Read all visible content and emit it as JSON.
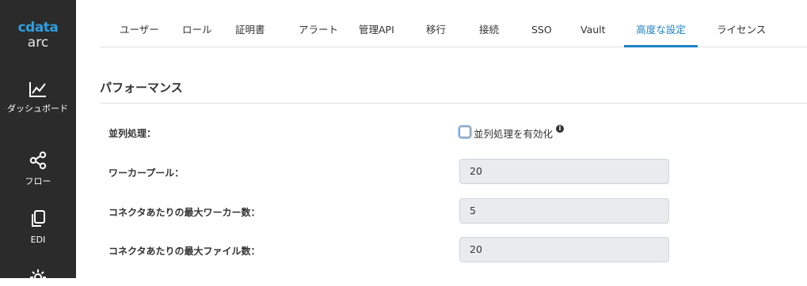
{
  "app": {
    "logo_text": "cdata",
    "logo_sub": "arc"
  },
  "sidebar": {
    "items": [
      {
        "label": "ダッシュボード",
        "icon": "chart-line-icon"
      },
      {
        "label": "フロー",
        "icon": "flow-share-icon"
      },
      {
        "label": "EDI",
        "icon": "documents-icon"
      },
      {
        "label": "",
        "icon": "gear-icon"
      }
    ]
  },
  "tabs": [
    {
      "label": "ユーザー"
    },
    {
      "label": "ロール"
    },
    {
      "label": "証明書"
    },
    {
      "label": "アラート"
    },
    {
      "label": "管理API"
    },
    {
      "label": "移行"
    },
    {
      "label": "接続"
    },
    {
      "label": "SSO"
    },
    {
      "label": "Vault"
    },
    {
      "label": "高度な設定",
      "active": true
    },
    {
      "label": "ライセンス"
    }
  ],
  "section": {
    "title": "パフォーマンス"
  },
  "settings": {
    "parallel": {
      "label": "並列処理：",
      "checkbox_label": "並列処理を有効化",
      "checked": false
    },
    "worker_pool": {
      "label": "ワーカープール：",
      "value": "20"
    },
    "max_workers": {
      "label": "コネクタあたりの最大ワーカー数：",
      "value": "5"
    },
    "max_files": {
      "label": "コネクタあたりの最大ファイル数：",
      "value": "20"
    }
  },
  "colors": {
    "accent": "#1e82c8",
    "sidebar_bg": "#2b2b2b",
    "logo": "#2f9fe0"
  }
}
